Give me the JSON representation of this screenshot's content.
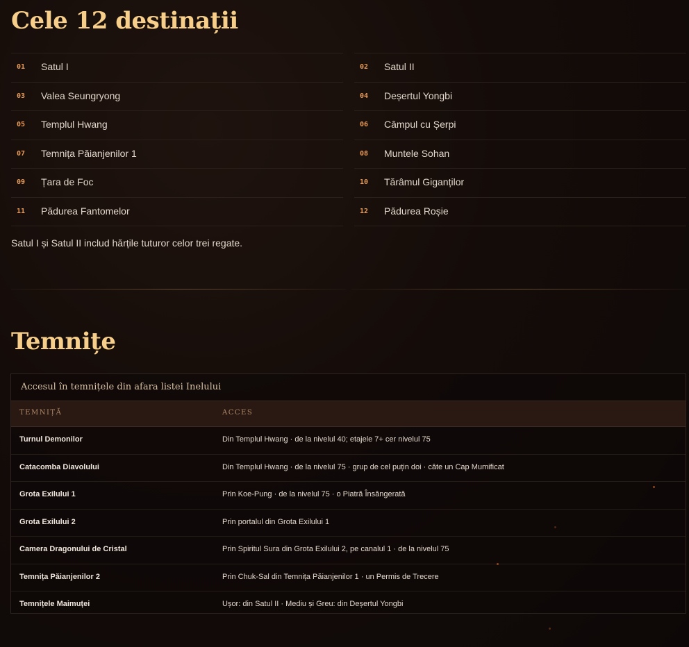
{
  "destinations": {
    "title": "Cele 12 destinații",
    "left": [
      {
        "num": "01",
        "name": "Satul I"
      },
      {
        "num": "03",
        "name": "Valea Seungryong"
      },
      {
        "num": "05",
        "name": "Templul Hwang"
      },
      {
        "num": "07",
        "name": "Temnița Păianjenilor 1"
      },
      {
        "num": "09",
        "name": "Țara de Foc"
      },
      {
        "num": "11",
        "name": "Pădurea Fantomelor"
      }
    ],
    "right": [
      {
        "num": "02",
        "name": "Satul II"
      },
      {
        "num": "04",
        "name": "Deșertul Yongbi"
      },
      {
        "num": "06",
        "name": "Câmpul cu Șerpi"
      },
      {
        "num": "08",
        "name": "Muntele Sohan"
      },
      {
        "num": "10",
        "name": "Tărâmul Giganților"
      },
      {
        "num": "12",
        "name": "Pădurea Roșie"
      }
    ],
    "note": "Satul I și Satul II includ hărțile tuturor celor trei regate."
  },
  "dungeons": {
    "title": "Temnițe",
    "caption": "Accesul în temnițele din afara listei Inelului",
    "headers": [
      "TEMNIȚĂ",
      "ACCES"
    ],
    "rows": [
      {
        "name": "Turnul Demonilor",
        "access": "Din Templul Hwang · de la nivelul 40; etajele 7+ cer nivelul 75"
      },
      {
        "name": "Catacomba Diavolului",
        "access": "Din Templul Hwang · de la nivelul 75 · grup de cel puțin doi · câte un Cap Mumificat"
      },
      {
        "name": "Grota Exilului 1",
        "access": "Prin Koe-Pung · de la nivelul 75 · o Piatră Însângerată"
      },
      {
        "name": "Grota Exilului 2",
        "access": "Prin portalul din Grota Exilului 1"
      },
      {
        "name": "Camera Dragonului de Cristal",
        "access": "Prin Spiritul Sura din Grota Exilului 2, pe canalul 1 · de la nivelul 75"
      },
      {
        "name": "Temnița Păianjenilor 2",
        "access": "Prin Chuk-Sal din Temnița Păianjenilor 1 · un Permis de Trecere"
      },
      {
        "name": "Temnițele Maimuței",
        "access": "Ușor: din Satul II · Mediu și Greu: din Deșertul Yongbi"
      }
    ]
  }
}
